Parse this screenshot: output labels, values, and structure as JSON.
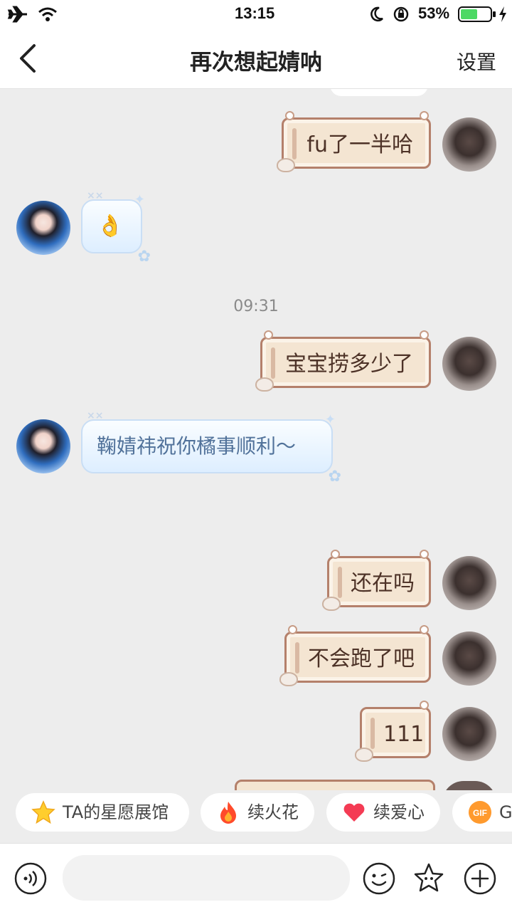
{
  "status": {
    "time": "13:15",
    "battery": "53%"
  },
  "header": {
    "title": "再次想起婧呐",
    "settings_label": "设置"
  },
  "messages": {
    "m1": "fu了一半哈",
    "m2": "👌",
    "timestamp": "09:31",
    "m3": "宝宝捞多少了",
    "m4": "鞠婧祎祝你橘事顺利～",
    "m5": "还在吗",
    "m6": "不会跑了吧",
    "m7": "111"
  },
  "chips": {
    "c1": "TA的星愿展馆",
    "c2": "续火花",
    "c3": "续爱心",
    "c4": "G"
  },
  "input": {
    "placeholder": ""
  },
  "colors": {
    "me_bubble": "#f4e5d2",
    "me_border": "#b4806b",
    "ta_bubble": "#ddeeff",
    "ta_text": "#51729a"
  }
}
